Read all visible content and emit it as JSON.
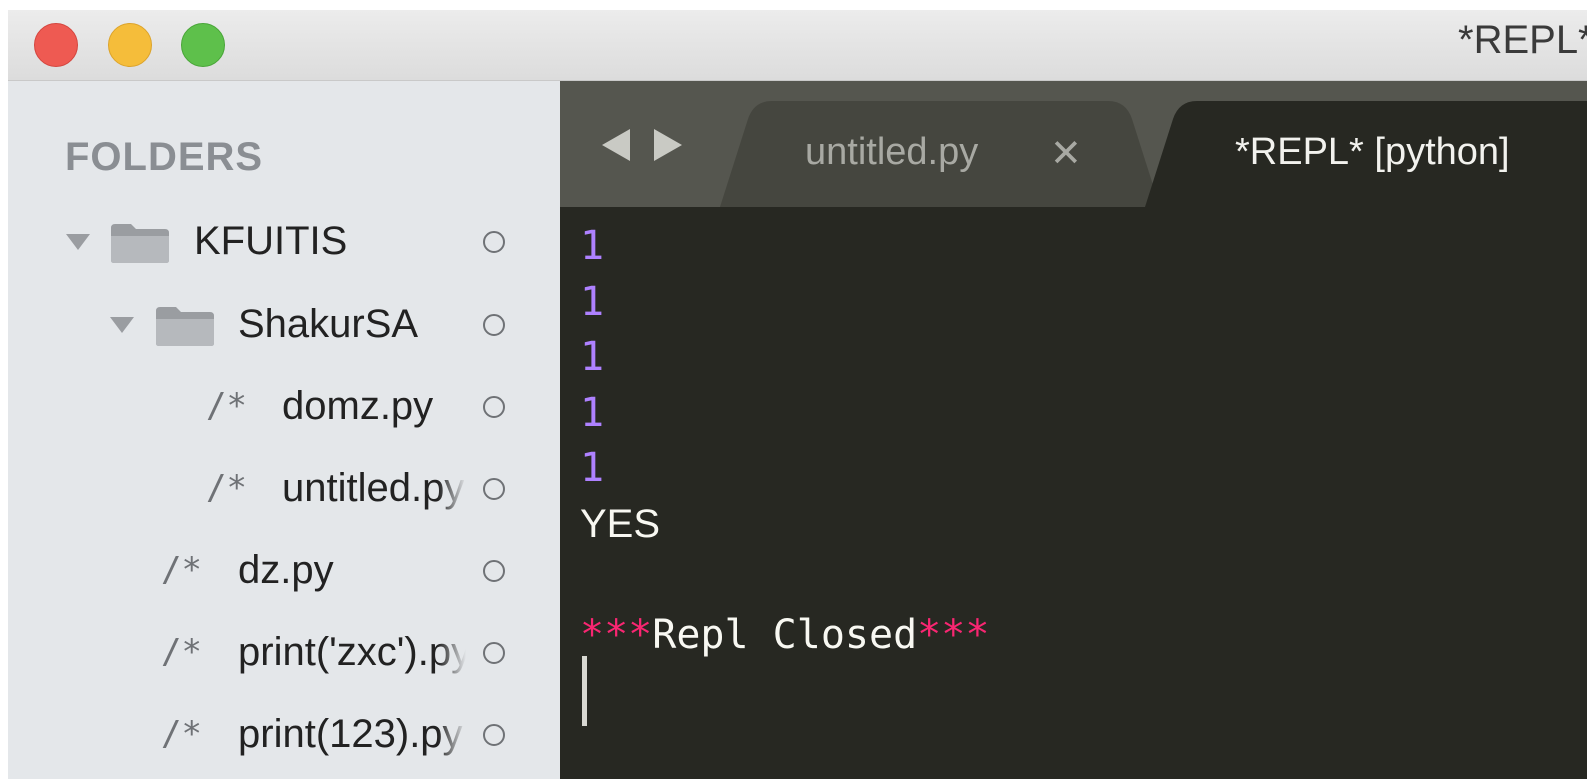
{
  "window": {
    "title": "*REPL* [python]"
  },
  "sidebar": {
    "header": "FOLDERS",
    "items": [
      {
        "label": "KFUITIS",
        "type": "folder",
        "expanded": true
      },
      {
        "label": "ShakurSA",
        "type": "folder",
        "expanded": true
      },
      {
        "label": "domz.py",
        "type": "file"
      },
      {
        "label": "untitled.py",
        "type": "file"
      },
      {
        "label": "dz.py",
        "type": "file"
      },
      {
        "label": "print('zxc').py",
        "type": "file"
      },
      {
        "label": "print(123).py",
        "type": "file"
      }
    ],
    "file_glyph": "/*"
  },
  "tabs": [
    {
      "label": "untitled.py",
      "active": false,
      "close_glyph": "✕"
    },
    {
      "label": "*REPL* [python]",
      "active": true
    }
  ],
  "repl": {
    "output_lines": [
      "1",
      "1",
      "1",
      "1",
      "1"
    ],
    "result": "YES",
    "closed_stars_left": "***",
    "closed_text": "Repl Closed",
    "closed_stars_right": "***"
  },
  "colors": {
    "editor_bg": "#272822",
    "number": "#ae81ff",
    "accent_pink": "#f92672",
    "sidebar_bg": "#e4e7ea",
    "traffic_close": "#ee5a52",
    "traffic_minimize": "#f5bd3a",
    "traffic_maximize": "#5ec04b"
  }
}
